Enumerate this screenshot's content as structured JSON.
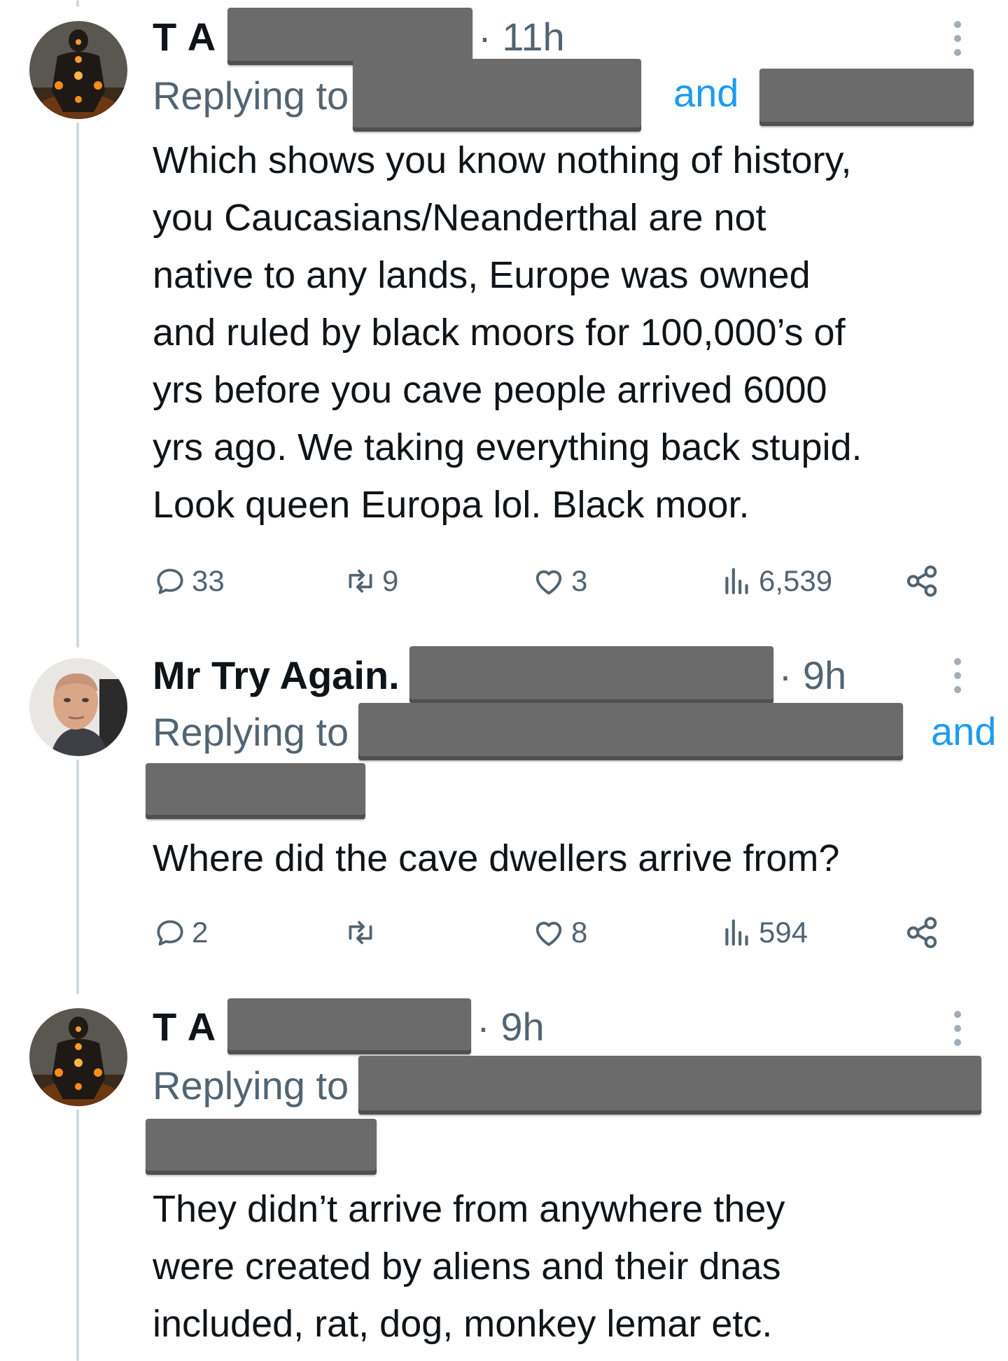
{
  "tweets": [
    {
      "display_name": "T A",
      "timestamp": "· 11h",
      "replying_label": "Replying to",
      "and_label": "and",
      "text": "Which shows you know nothing of history,\nyou Caucasians/Neanderthal are not\nnative to any lands, Europe was owned\nand ruled by black moors for 100,000’s of\nyrs before you cave people arrived 6000\nyrs ago. We taking everything back stupid.\nLook queen Europa lol. Black moor.",
      "actions": {
        "reply_count": "33",
        "retweet_count": "9",
        "like_count": "3",
        "view_count": "6,539"
      }
    },
    {
      "display_name": "Mr Try Again.",
      "timestamp": "· 9h",
      "replying_label": "Replying to",
      "and_label": "and",
      "text": "Where did the cave dwellers arrive from?",
      "actions": {
        "reply_count": "2",
        "retweet_count": "",
        "like_count": "8",
        "view_count": "594"
      }
    },
    {
      "display_name": "T A",
      "timestamp": "· 9h",
      "replying_label": "Replying to",
      "text": "They didn’t arrive from anywhere they\nwere created by aliens and their dnas\nincluded, rat, dog, monkey lemar etc."
    }
  ],
  "icons": {
    "reply": "reply-icon",
    "retweet": "retweet-icon",
    "like": "heart-icon",
    "views": "views-icon",
    "share": "share-icon",
    "more": "more-icon"
  },
  "colors": {
    "link_blue": "#1d9bf0",
    "secondary_text": "#536471",
    "redaction": "#6b6b6b",
    "thread_line": "#cfd9de"
  }
}
